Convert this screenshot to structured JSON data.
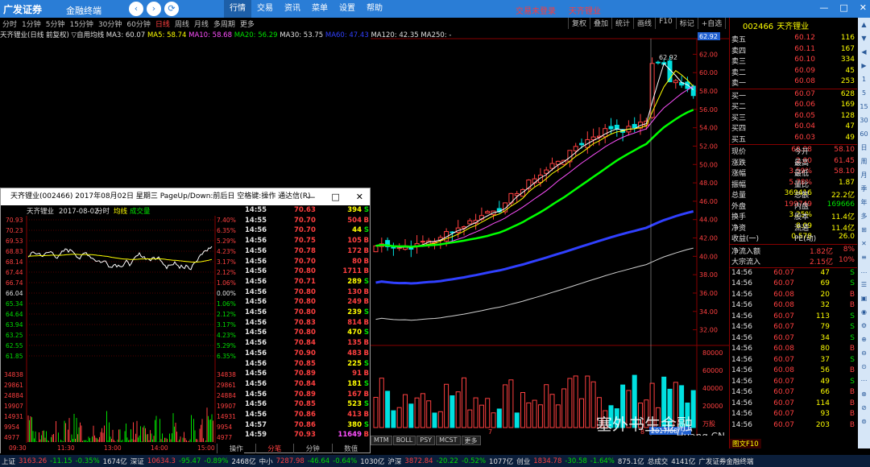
{
  "topbar": {
    "logo": "广发证券",
    "subtitle": "金融终端",
    "nav_back": "‹",
    "nav_fwd": "›",
    "nav_refresh": "⟳",
    "menus": [
      "行情",
      "交易",
      "资讯",
      "菜单",
      "设置",
      "帮助"
    ],
    "active_menu": "行情",
    "trade_status": "交易未登录",
    "stock_name_tag": "天齐锂业",
    "window_controls": [
      "—",
      "□",
      "✕"
    ]
  },
  "periods": [
    "分时",
    "1分钟",
    "5分钟",
    "15分钟",
    "30分钟",
    "60分钟",
    "日线",
    "周线",
    "月线",
    "多周期",
    "更多"
  ],
  "selected_period": "日线",
  "chart_tools": [
    "复权",
    "叠加",
    "统计",
    "画线",
    "F10",
    "标记",
    "+自选",
    "返回"
  ],
  "indicator_line": {
    "title": "天齐锂业(日线 前复权) ▽自用均线",
    "ma3": "MA3: 60.07",
    "ma5": "MA5: 58.74",
    "ma10": "MA10: 58.68",
    "ma20": "MA20: 56.29",
    "ma30": "MA30: 53.75",
    "ma60": "MA60: 47.43",
    "ma120": "MA120: 42.35",
    "ma250": "MA250: -"
  },
  "price_axis": [
    "62.00",
    "60.00",
    "58.00",
    "56.00",
    "54.00",
    "52.00",
    "50.00",
    "48.00",
    "46.00",
    "44.00",
    "42.00",
    "40.00",
    "38.00",
    "36.00",
    "34.00",
    "32.00"
  ],
  "price_highlight": "62.92",
  "vol_axis": [
    "80000",
    "60000",
    "40000",
    "20000",
    "万股"
  ],
  "top_price_label": "62.92",
  "date_label": "2017/08/",
  "vol_marks": [
    "7",
    "8"
  ],
  "bottom_tabs": [
    "MTM",
    "BOLL",
    "PSY",
    "MCST",
    "更多"
  ],
  "popup": {
    "title": "天齐锂业(002466) 2017年08月02日 星期三 PageUp/Down:前后日 空格键:操作 通达信(R)",
    "window_controls": [
      "—",
      "□",
      "✕"
    ],
    "header_name": "天齐锂业",
    "header_date": "2017-08-02",
    "header_mode": "分时",
    "header_avg": "均线",
    "header_vol": "成交量",
    "price_left": [
      "70.93",
      "70.23",
      "69.53",
      "68.83",
      "68.14",
      "67.44",
      "66.74",
      "66.04",
      "65.34",
      "64.64",
      "63.94",
      "63.25",
      "62.55",
      "61.85"
    ],
    "pct_right": [
      "7.40%",
      "6.35%",
      "5.29%",
      "4.23%",
      "3.17%",
      "2.12%",
      "1.06%",
      "0.00%",
      "1.06%",
      "2.12%",
      "3.17%",
      "4.23%",
      "5.29%",
      "6.35%"
    ],
    "vol_left": [
      "34838",
      "29861",
      "24884",
      "19907",
      "14931",
      "9954",
      "4977"
    ],
    "vol_right": [
      "34838",
      "29861",
      "24884",
      "19907",
      "14931",
      "9954",
      "4977"
    ],
    "time_axis": [
      "09:30",
      "11:30",
      "13:00",
      "14:00",
      "15:00"
    ],
    "tabs": [
      "操作",
      "分笔",
      "分钟",
      "数值"
    ],
    "active_tab": "分笔",
    "ticks": [
      {
        "t": "14:55",
        "p": "70.63",
        "v": "394",
        "bs": "S"
      },
      {
        "t": "14:55",
        "p": "70.70",
        "v": "504",
        "bs": "B"
      },
      {
        "t": "14:56",
        "p": "70.70",
        "v": "44",
        "bs": "S"
      },
      {
        "t": "14:56",
        "p": "70.75",
        "v": "105",
        "bs": "B"
      },
      {
        "t": "14:56",
        "p": "70.78",
        "v": "172",
        "bs": "B"
      },
      {
        "t": "14:56",
        "p": "70.70",
        "v": "80",
        "bs": "B"
      },
      {
        "t": "14:56",
        "p": "70.80",
        "v": "1711",
        "bs": "B"
      },
      {
        "t": "14:56",
        "p": "70.71",
        "v": "289",
        "bs": "S"
      },
      {
        "t": "14:56",
        "p": "70.80",
        "v": "130",
        "bs": "B"
      },
      {
        "t": "14:56",
        "p": "70.80",
        "v": "249",
        "bs": "B"
      },
      {
        "t": "14:56",
        "p": "70.80",
        "v": "239",
        "bs": "S"
      },
      {
        "t": "14:56",
        "p": "70.83",
        "v": "814",
        "bs": "B"
      },
      {
        "t": "14:56",
        "p": "70.80",
        "v": "470",
        "bs": "S"
      },
      {
        "t": "14:56",
        "p": "70.84",
        "v": "135",
        "bs": "B"
      },
      {
        "t": "14:56",
        "p": "70.90",
        "v": "483",
        "bs": "B"
      },
      {
        "t": "14:56",
        "p": "70.85",
        "v": "225",
        "bs": "S"
      },
      {
        "t": "14:56",
        "p": "70.89",
        "v": "91",
        "bs": "B"
      },
      {
        "t": "14:56",
        "p": "70.84",
        "v": "181",
        "bs": "S"
      },
      {
        "t": "14:56",
        "p": "70.89",
        "v": "167",
        "bs": "B"
      },
      {
        "t": "14:56",
        "p": "70.85",
        "v": "523",
        "bs": "S"
      },
      {
        "t": "14:56",
        "p": "70.86",
        "v": "413",
        "bs": "B"
      },
      {
        "t": "14:57",
        "p": "70.86",
        "v": "380",
        "bs": "S"
      },
      {
        "t": "14:59",
        "p": "70.93",
        "v": "11649",
        "bs": "B"
      }
    ]
  },
  "quote": {
    "code": "002466",
    "name": "天齐锂业",
    "asks": [
      {
        "l": "卖五",
        "p": "60.12",
        "v": "116"
      },
      {
        "l": "卖四",
        "p": "60.11",
        "v": "167"
      },
      {
        "l": "卖三",
        "p": "60.10",
        "v": "334"
      },
      {
        "l": "卖二",
        "p": "60.09",
        "v": "45"
      },
      {
        "l": "卖一",
        "p": "60.08",
        "v": "253"
      }
    ],
    "bids": [
      {
        "l": "买一",
        "p": "60.07",
        "v": "628"
      },
      {
        "l": "买二",
        "p": "60.06",
        "v": "169"
      },
      {
        "l": "买三",
        "p": "60.05",
        "v": "128"
      },
      {
        "l": "买四",
        "p": "60.04",
        "v": "47"
      },
      {
        "l": "买五",
        "p": "60.03",
        "v": "49"
      }
    ],
    "stats": [
      {
        "l1": "现价",
        "v1": "60.08",
        "l2": "今开",
        "v2": "58.10"
      },
      {
        "l1": "涨跌",
        "v1": "2.00",
        "l2": "最高",
        "v2": "61.45"
      },
      {
        "l1": "涨幅",
        "v1": "3.59%",
        "l2": "最低",
        "v2": "58.10"
      },
      {
        "l1": "振幅",
        "v1": "5.78%",
        "l2": "量比",
        "v2": "1.87"
      },
      {
        "l1": "总量",
        "v1": "369416",
        "l2": "总额",
        "v2": "22.2亿"
      },
      {
        "l1": "外盘",
        "v1": "199749",
        "l2": "内盘",
        "v2": "169666"
      },
      {
        "l1": "换手",
        "v1": "3.25%",
        "l2": "股本",
        "v2": "11.4亿"
      },
      {
        "l1": "净资",
        "v1": "8.09",
        "l2": "流通",
        "v2": "11.4亿"
      },
      {
        "l1": "收益(一)",
        "v1": "0.578",
        "l2": "PE(动)",
        "v2": "26.0"
      }
    ],
    "flows": [
      {
        "l": "净流入额",
        "v": "1.82亿",
        "p": "8%"
      },
      {
        "l": "大宗流入",
        "v": "2.15亿",
        "p": "10%"
      }
    ],
    "trades": [
      {
        "t": "14:56",
        "p": "60.07",
        "v": "47",
        "bs": "S"
      },
      {
        "t": "14:56",
        "p": "60.07",
        "v": "69",
        "bs": "S"
      },
      {
        "t": "14:56",
        "p": "60.08",
        "v": "20",
        "bs": "B"
      },
      {
        "t": "14:56",
        "p": "60.08",
        "v": "32",
        "bs": "B"
      },
      {
        "t": "14:56",
        "p": "60.07",
        "v": "113",
        "bs": "S"
      },
      {
        "t": "14:56",
        "p": "60.07",
        "v": "79",
        "bs": "S"
      },
      {
        "t": "14:56",
        "p": "60.07",
        "v": "34",
        "bs": "S"
      },
      {
        "t": "14:56",
        "p": "60.08",
        "v": "80",
        "bs": "B"
      },
      {
        "t": "14:56",
        "p": "60.07",
        "v": "37",
        "bs": "S"
      },
      {
        "t": "14:56",
        "p": "60.08",
        "v": "56",
        "bs": "B"
      },
      {
        "t": "14:56",
        "p": "60.07",
        "v": "49",
        "bs": "S"
      },
      {
        "t": "14:56",
        "p": "60.07",
        "v": "66",
        "bs": "B"
      },
      {
        "t": "14:56",
        "p": "60.07",
        "v": "114",
        "bs": "B"
      },
      {
        "t": "14:56",
        "p": "60.07",
        "v": "93",
        "bs": "B"
      },
      {
        "t": "14:56",
        "p": "60.07",
        "v": "203",
        "bs": "B"
      }
    ],
    "f10_tag": "图文F10"
  },
  "side_tabs": [
    "▲",
    "▼",
    "◀",
    "▶",
    "1",
    "5",
    "15",
    "30",
    "60",
    "日",
    "周",
    "月",
    "季",
    "年",
    "多",
    "⊞",
    "✕",
    "≡",
    "…",
    "☰",
    "▣",
    "◉",
    "⚙",
    "⊕",
    "⊖",
    "⊙",
    "⋯",
    "⊗",
    "⊘",
    "⊚"
  ],
  "statusbar": [
    {
      "t": "上证",
      "c": "white"
    },
    {
      "t": "3163.26",
      "c": "red"
    },
    {
      "t": "-11.15",
      "c": "green"
    },
    {
      "t": "-0.35%",
      "c": "green"
    },
    {
      "t": "1674亿",
      "c": "white"
    },
    {
      "t": "深证",
      "c": "white"
    },
    {
      "t": "10634.3",
      "c": "red"
    },
    {
      "t": "-95.47",
      "c": "green"
    },
    {
      "t": "-0.89%",
      "c": "green"
    },
    {
      "t": "2468亿",
      "c": "white"
    },
    {
      "t": "中小",
      "c": "white"
    },
    {
      "t": "7287.98",
      "c": "red"
    },
    {
      "t": "-46.64",
      "c": "green"
    },
    {
      "t": "-0.64%",
      "c": "green"
    },
    {
      "t": "1030亿",
      "c": "white"
    },
    {
      "t": "沪深",
      "c": "white"
    },
    {
      "t": "3872.84",
      "c": "red"
    },
    {
      "t": "-20.22",
      "c": "green"
    },
    {
      "t": "-0.52%",
      "c": "green"
    },
    {
      "t": "1077亿",
      "c": "white"
    },
    {
      "t": "创业",
      "c": "white"
    },
    {
      "t": "1834.78",
      "c": "red"
    },
    {
      "t": "-30.58",
      "c": "green"
    },
    {
      "t": "-1.64%",
      "c": "green"
    },
    {
      "t": "875.1亿",
      "c": "white"
    },
    {
      "t": "总成交",
      "c": "white"
    },
    {
      "t": "4141亿",
      "c": "white"
    },
    {
      "t": "广发证券金融终端",
      "c": "white"
    }
  ],
  "colors": {
    "bg": "#000000",
    "up": "#ff4040",
    "down": "#00e0e0",
    "ma3": "#ffffff",
    "ma5": "#ffff00",
    "ma10": "#ff50ff",
    "ma20": "#00ff00",
    "ma60": "#3040ff",
    "ma120": "#d0d0d0"
  },
  "watermark": "塞外书生金融",
  "watermark2": "Huang.CN"
}
